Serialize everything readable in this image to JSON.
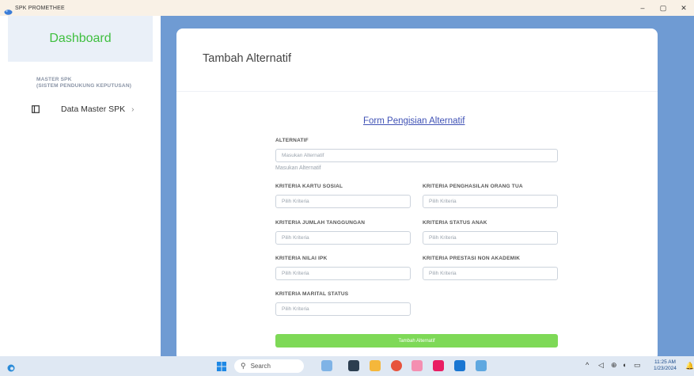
{
  "window": {
    "title": "SPK PROMETHEE",
    "controls": {
      "minimize": "–",
      "maximize": "▢",
      "close": "✕"
    }
  },
  "sidebar": {
    "title": "Dashboard",
    "section_line1": "MASTER SPK",
    "section_line2": "(SISTEM PENDUKUNG KEPUTUSAN)",
    "items": [
      {
        "label": "Data Master SPK",
        "chevron": "›",
        "icon": "window-icon"
      }
    ]
  },
  "page": {
    "title": "Tambah Alternatif",
    "form_title": "Form Pengisian Alternatif",
    "alternatif": {
      "label": "ALTERNATIF",
      "placeholder": "Masukan Alternatif",
      "help": "Masukan Alternatif"
    },
    "criteria": [
      {
        "label": "KRITERIA KARTU SOSIAL",
        "placeholder": "Pilih Kriteria"
      },
      {
        "label": "KRITERIA PENGHASILAN ORANG TUA",
        "placeholder": "Pilih Kriteria"
      },
      {
        "label": "KRITERIA JUMLAH TANGGUNGAN",
        "placeholder": "Pilih Kriteria"
      },
      {
        "label": "KRITERIA STATUS ANAK",
        "placeholder": "Pilih Kriteria"
      },
      {
        "label": "KRITERIA NILAI IPK",
        "placeholder": "Pilih Kriteria"
      },
      {
        "label": "KRITERIA PRESTASI NON AKADEMIK",
        "placeholder": "Pilih Kriteria"
      },
      {
        "label": "KRITERIA MARITAL STATUS",
        "placeholder": "Pilih Kriteria"
      }
    ],
    "submit_label": "Tambah Alternatif"
  },
  "taskbar": {
    "search_label": "Search",
    "clock_time": "11:25 AM",
    "clock_date": "1/23/2024",
    "tray_chevron": "^",
    "colors": {
      "accent": "#6f9bd3",
      "submit": "#7ed957",
      "brand_green": "#3fbf3f"
    }
  }
}
